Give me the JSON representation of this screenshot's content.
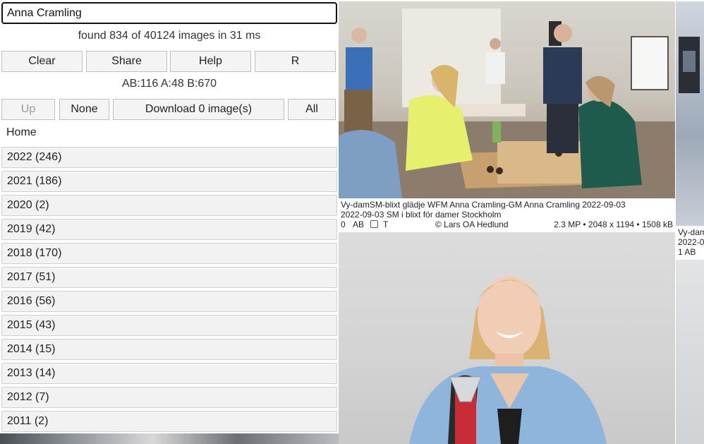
{
  "search": {
    "value": "Anna Cramling"
  },
  "status": {
    "found": "found 834 of 40124 images in 31 ms",
    "counts": "AB:116 A:48 B:670"
  },
  "toolbar1": {
    "clear": "Clear",
    "share": "Share",
    "help": "Help",
    "r": "R"
  },
  "toolbar2": {
    "up": "Up",
    "none": "None",
    "download": "Download 0 image(s)",
    "all": "All"
  },
  "nav": {
    "home": "Home"
  },
  "years": [
    "2022 (246)",
    "2021 (186)",
    "2020 (2)",
    "2019 (42)",
    "2018 (170)",
    "2017 (51)",
    "2016 (56)",
    "2015 (43)",
    "2014 (15)",
    "2013 (14)",
    "2012 (7)",
    "2011 (2)"
  ],
  "gallery": {
    "card1": {
      "caption1": "Vy-damSM-blixt glädje WFM Anna Cramling-GM Anna Cramling 2022-09-03",
      "caption2": "2022-09-03 SM i blixt för damer Stockholm",
      "index": "0",
      "ab": "AB",
      "t": "T",
      "copyright": "© Lars OA Hedlund",
      "size": "2.3 MP • 2048 x 1194 • 1508 kB"
    },
    "card3": {
      "caption1": "Vy-dam",
      "caption2": "2022-0",
      "meta": "1  AB"
    }
  }
}
